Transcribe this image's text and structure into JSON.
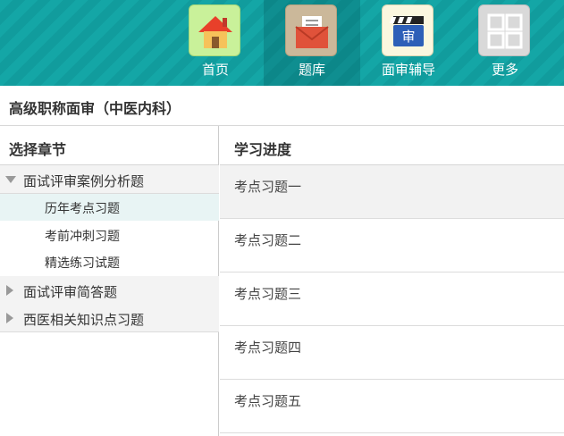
{
  "nav": {
    "items": [
      {
        "label": "首页",
        "icon": "house-icon"
      },
      {
        "label": "题库",
        "icon": "envelope-icon"
      },
      {
        "label": "面审辅导",
        "icon": "clapperboard-icon",
        "icon_text": "审"
      },
      {
        "label": "更多",
        "icon": "grid-icon"
      }
    ],
    "active_index": 1
  },
  "title": "高级职称面审（中医内科）",
  "left_panel": {
    "header": "选择章节",
    "chapters": [
      {
        "label": "面试评审案例分析题",
        "expanded": true,
        "subitems": [
          "历年考点习题",
          "考前冲刺习题",
          "精选练习试题"
        ],
        "active_subitem": 0
      },
      {
        "label": "面试评审简答题",
        "expanded": false
      },
      {
        "label": "西医相关知识点习题",
        "expanded": false
      }
    ]
  },
  "right_panel": {
    "header": "学习进度",
    "rows": [
      "考点习题一",
      "考点习题二",
      "考点习题三",
      "考点习题四",
      "考点习题五"
    ],
    "active_row": 0
  },
  "colors": {
    "topbar": "#14a6a6",
    "active_sub_bg": "#e8f4f4",
    "chapter_bg": "#f3f3f3"
  }
}
